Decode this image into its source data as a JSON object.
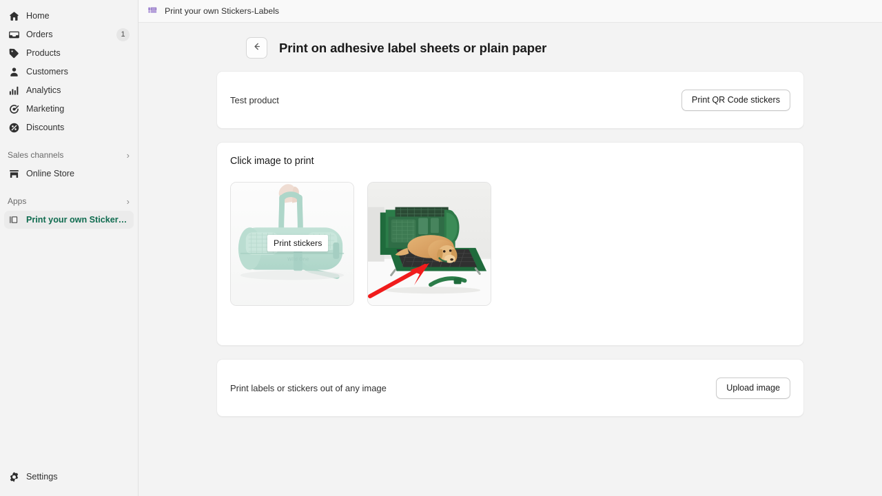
{
  "sidebar": {
    "items": [
      {
        "label": "Home",
        "icon": "home-icon",
        "badge": null
      },
      {
        "label": "Orders",
        "icon": "orders-icon",
        "badge": "1"
      },
      {
        "label": "Products",
        "icon": "products-tag-icon",
        "badge": null
      },
      {
        "label": "Customers",
        "icon": "customers-person-icon",
        "badge": null
      },
      {
        "label": "Analytics",
        "icon": "analytics-bars-icon",
        "badge": null
      },
      {
        "label": "Marketing",
        "icon": "marketing-megaphone-icon",
        "badge": null
      },
      {
        "label": "Discounts",
        "icon": "discounts-percent-icon",
        "badge": null
      }
    ],
    "sales_channels": {
      "label": "Sales channels",
      "chevron": "›"
    },
    "online_store": {
      "label": "Online Store",
      "icon": "storefront-icon"
    },
    "apps": {
      "label": "Apps",
      "chevron": "›"
    },
    "active_app": {
      "label": "Print your own Stickers-L...",
      "icon": "stickers-labels-icon"
    },
    "settings": {
      "label": "Settings",
      "icon": "gear-icon"
    },
    "active_color": "#0f6b4f"
  },
  "topbar": {
    "app_title": "Print your own Stickers-Labels",
    "app_icon": "stickers-labels-icon",
    "icon_color": "#8a6cbf"
  },
  "page": {
    "back_icon": "arrow-left-icon",
    "title": "Print on adhesive label sheets or plain paper"
  },
  "product_card": {
    "product_name": "Test product",
    "button_label": "Print QR Code stickers"
  },
  "images_card": {
    "title": "Click image to print",
    "thumbnails": [
      {
        "alt": "mint-green-pet-carrier-bag-held-by-hand",
        "tooltip": "Print stickers",
        "highlighted": true
      },
      {
        "alt": "dog-in-open-green-pet-carrier",
        "tooltip": null,
        "highlighted": false
      }
    ]
  },
  "upload_card": {
    "text": "Print labels or stickers out of any image",
    "button_label": "Upload image"
  },
  "annotation": {
    "arrow_color": "#f01c1c",
    "arrow_name": "red-pointer-arrow"
  }
}
